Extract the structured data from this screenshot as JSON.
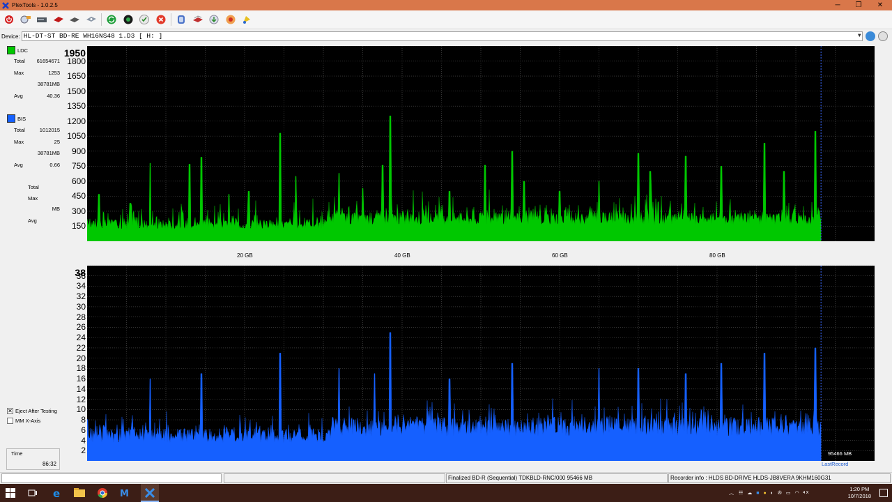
{
  "window": {
    "title": "PlexTools - 1.0.2.5",
    "minimize": "─",
    "restore": "❐",
    "close": "✕"
  },
  "toolbar": {
    "buttons": [
      "power-icon",
      "cd-tool-icon",
      "drive-icon",
      "red-disc-icon",
      "disc-icon",
      "disc-tray-icon",
      "refresh-icon",
      "globe-icon",
      "check-icon",
      "stop-icon",
      "settings-icon",
      "copy-icon",
      "export-icon",
      "burn-icon",
      "help-icon"
    ]
  },
  "device": {
    "label": "Device:",
    "value": "HL-DT-ST BD-RE  WH16NS48  1.D3 [ H: ]"
  },
  "ldc": {
    "label": "LDC",
    "color": "#00d000",
    "total_label": "Total",
    "total": "61654671",
    "max_label": "Max",
    "max": "1253",
    "max_mb": "38781MB",
    "avg_label": "Avg",
    "avg": "40.36"
  },
  "bis": {
    "label": "BIS",
    "color": "#1560ff",
    "total_label": "Total",
    "total": "1012015",
    "max_label": "Max",
    "max": "25",
    "max_mb": "38781MB",
    "avg_label": "Avg",
    "avg": "0.66"
  },
  "third": {
    "total_label": "Total",
    "max_label": "Max",
    "mb_label": "MB",
    "avg_label": "Avg"
  },
  "options": {
    "eject_label": "Eject After Testing",
    "eject_checked": true,
    "mm_label": "MM X-Axis",
    "mm_checked": false
  },
  "time": {
    "label": "Time",
    "value": "86:32"
  },
  "chart_data": [
    {
      "type": "area",
      "name": "LDC",
      "y_ticks": [
        "1950",
        "1800",
        "1650",
        "1500",
        "1350",
        "1200",
        "1050",
        "900",
        "750",
        "600",
        "450",
        "300",
        "150"
      ],
      "x_ticks": [
        "20 GB",
        "40 GB",
        "60 GB",
        "80 GB"
      ],
      "ylim": [
        0,
        1950
      ],
      "xlim_gb": [
        0,
        100
      ],
      "data_end_gb": 93.2,
      "color": "#00c800",
      "peaks": [
        [
          1.5,
          470
        ],
        [
          5.5,
          380
        ],
        [
          8,
          780
        ],
        [
          13,
          770
        ],
        [
          14.5,
          840
        ],
        [
          18,
          470
        ],
        [
          20.5,
          500
        ],
        [
          24.5,
          1080
        ],
        [
          26.5,
          650
        ],
        [
          32,
          680
        ],
        [
          35,
          530
        ],
        [
          37.5,
          760
        ],
        [
          38.5,
          1253
        ],
        [
          46,
          500
        ],
        [
          50.5,
          760
        ],
        [
          54,
          900
        ],
        [
          55.5,
          600
        ],
        [
          60,
          500
        ],
        [
          65,
          600
        ],
        [
          70,
          880
        ],
        [
          71.5,
          700
        ],
        [
          76,
          850
        ],
        [
          80.5,
          750
        ],
        [
          86,
          980
        ],
        [
          88.5,
          700
        ],
        [
          92.5,
          1100
        ]
      ],
      "baseline": 120
    },
    {
      "type": "area",
      "name": "BIS",
      "y_ticks": [
        "38",
        "36",
        "34",
        "32",
        "30",
        "28",
        "26",
        "24",
        "22",
        "20",
        "18",
        "16",
        "14",
        "12",
        "10",
        "8",
        "6",
        "4",
        "2"
      ],
      "x_ticks": [
        "20 GB",
        "40 GB",
        "60 GB",
        "80 GB"
      ],
      "ylim": [
        0,
        38
      ],
      "xlim_gb": [
        0,
        100
      ],
      "data_end_gb": 93.2,
      "color": "#1560ff",
      "peaks": [
        [
          8,
          16
        ],
        [
          14.5,
          17
        ],
        [
          24.5,
          21
        ],
        [
          32,
          18
        ],
        [
          36.5,
          17
        ],
        [
          38.5,
          25
        ],
        [
          46,
          16
        ],
        [
          54,
          19
        ],
        [
          65,
          18
        ],
        [
          70,
          18
        ],
        [
          76,
          17
        ],
        [
          80.5,
          19
        ],
        [
          86,
          21
        ],
        [
          92.5,
          22
        ]
      ],
      "baseline": 3.5,
      "end_label": "95466 MB",
      "last_record_label": "LastRecord"
    }
  ],
  "status": {
    "field1": "",
    "field2": "",
    "disc": "Finalized   BD-R (Sequential)   TDKBLD-RNC/000   95466 MB",
    "recorder": "Recorder info : HLDS BD-DRIVE   HLDS-JB8VERA    9KHM160G31"
  },
  "taskbar": {
    "icons": [
      "windows-start-icon",
      "task-view-icon",
      "edge-icon",
      "explorer-icon",
      "chrome-icon",
      "mail-icon",
      "excel-icon",
      "plextools-icon"
    ],
    "time": "1:20 PM",
    "date": "10/7/2018"
  }
}
